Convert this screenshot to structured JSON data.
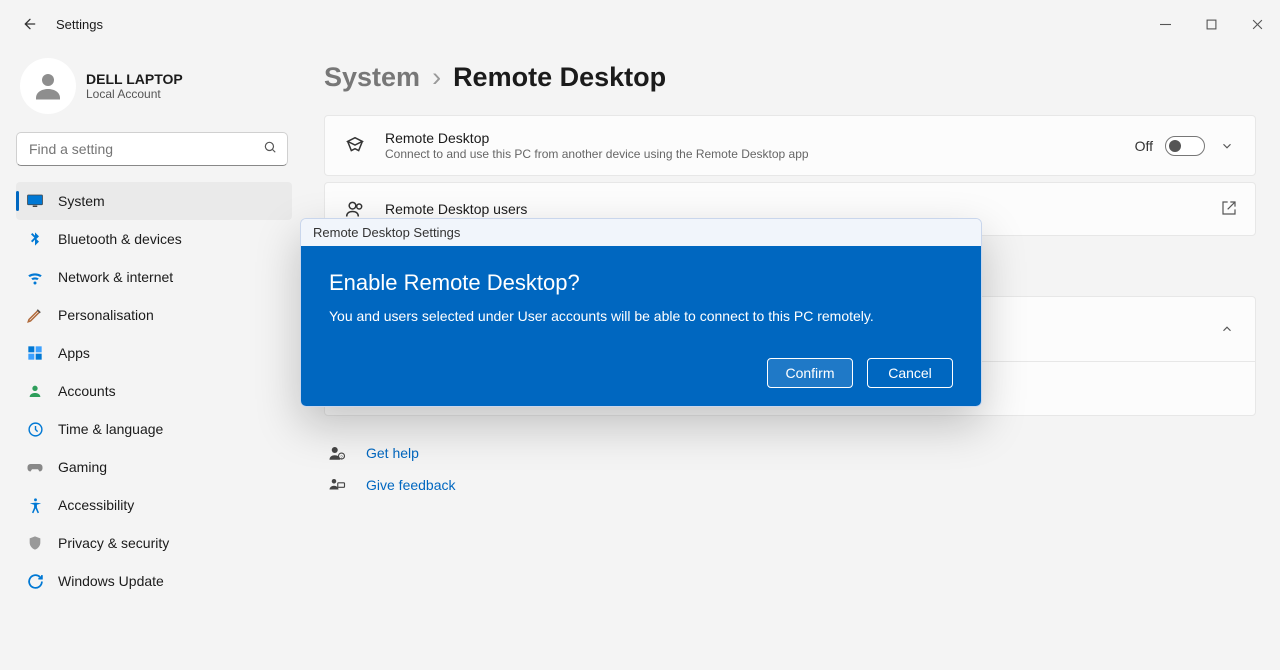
{
  "window": {
    "title": "Settings"
  },
  "profile": {
    "name": "DELL LAPTOP",
    "account_type": "Local Account"
  },
  "search": {
    "placeholder": "Find a setting"
  },
  "sidebar": {
    "items": [
      {
        "icon": "system-icon",
        "label": "System",
        "active": true
      },
      {
        "icon": "bluetooth-icon",
        "label": "Bluetooth & devices",
        "active": false
      },
      {
        "icon": "network-icon",
        "label": "Network & internet",
        "active": false
      },
      {
        "icon": "personalisation-icon",
        "label": "Personalisation",
        "active": false
      },
      {
        "icon": "apps-icon",
        "label": "Apps",
        "active": false
      },
      {
        "icon": "accounts-icon",
        "label": "Accounts",
        "active": false
      },
      {
        "icon": "time-icon",
        "label": "Time & language",
        "active": false
      },
      {
        "icon": "gaming-icon",
        "label": "Gaming",
        "active": false
      },
      {
        "icon": "accessibility-icon",
        "label": "Accessibility",
        "active": false
      },
      {
        "icon": "privacy-icon",
        "label": "Privacy & security",
        "active": false
      },
      {
        "icon": "update-icon",
        "label": "Windows Update",
        "active": false
      }
    ]
  },
  "breadcrumb": {
    "parent": "System",
    "current": "Remote Desktop"
  },
  "main": {
    "remote_desktop": {
      "title": "Remote Desktop",
      "subtitle": "Connect to and use this PC from another device using the Remote Desktop app",
      "state_label": "Off"
    },
    "remote_desktop_users": {
      "title": "Remote Desktop users"
    }
  },
  "help_links": {
    "get_help": "Get help",
    "give_feedback": "Give feedback"
  },
  "dialog": {
    "titlebar": "Remote Desktop Settings",
    "heading": "Enable Remote Desktop?",
    "message": "You and users selected under User accounts will be able to connect to this PC remotely.",
    "confirm_label": "Confirm",
    "cancel_label": "Cancel"
  }
}
